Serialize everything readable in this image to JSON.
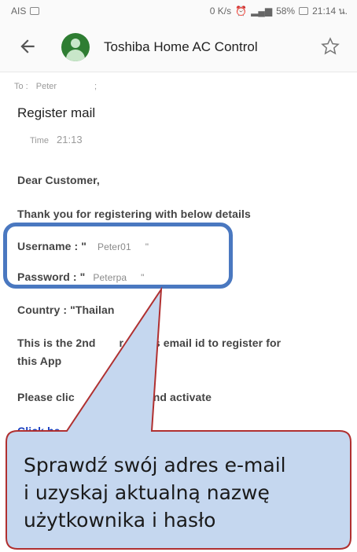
{
  "status_bar": {
    "carrier": "AIS",
    "network_speed": "0 K/s",
    "battery": "58%",
    "time": "21:14 น."
  },
  "app_bar": {
    "title": "Toshiba Home AC Control",
    "back_icon": "arrow-left-icon",
    "avatar_icon": "person-icon",
    "star_icon": "star-outline-icon"
  },
  "email": {
    "to_label": "To :",
    "to_value": "Peter",
    "to_separator": ";",
    "subject": "Register mail",
    "time_label": "Time",
    "time_value": "21:13",
    "greeting": "Dear Customer,",
    "intro": "Thank you for registering with below details",
    "username_label": "Username : \"",
    "username_value": "Peter01",
    "username_close": "\"",
    "password_label": "Password : \"",
    "password_value": "Peterpa",
    "password_close": "\"",
    "country": "Country : \"Thailan",
    "attempt_line1": "This is the 2nd",
    "attempt_line1_end": "r of this email id to register for",
    "attempt_line2": "this App",
    "activate_start": "Please clic",
    "activate_end": "below and activate",
    "link_text": "Click he"
  },
  "callout": {
    "text_line1": "Sprawdź swój adres e-mail",
    "text_line2": "i uzyskaj aktualną nazwę",
    "text_line3": "użytkownika i hasło",
    "fill_color": "#c5d7ef",
    "border_color": "#b03030"
  },
  "highlight": {
    "border_color": "#4a78c0"
  }
}
